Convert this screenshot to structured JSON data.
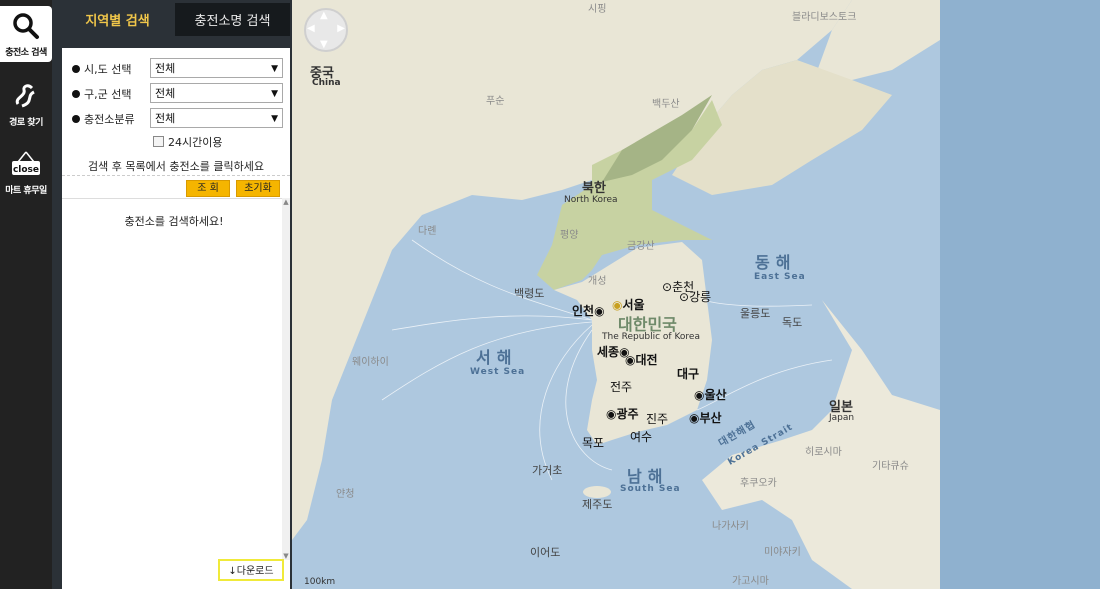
{
  "rail": {
    "items": [
      {
        "label": "충전소 검색",
        "icon": "search-icon"
      },
      {
        "label": "경로 찾기",
        "icon": "route-icon"
      },
      {
        "label": "마트 휴무일",
        "icon": "close-sign-icon",
        "badge": "close"
      }
    ]
  },
  "tabs": [
    {
      "label": "지역별 검색"
    },
    {
      "label": "충전소명 검색"
    }
  ],
  "form": {
    "sido_label": "시,도 선택",
    "sido_value": "전체",
    "gugun_label": "구,군 선택",
    "gugun_value": "전체",
    "type_label": "충전소분류",
    "type_value": "전체",
    "allday_label": "24시간이용",
    "hint": "검색 후 목록에서 충전소를 클릭하세요"
  },
  "buttons": {
    "search": "조 회",
    "reset": "초기화",
    "download": "다운로드"
  },
  "list": {
    "empty_text": "충전소를 검색하세요!"
  },
  "map": {
    "labels": {
      "china": "중국",
      "china_en": "China",
      "north": "북한",
      "north_en": "North Korea",
      "south": "대한민국",
      "south_en": "The Republic of Korea",
      "east_sea": "동해",
      "east_sea_en": "East Sea",
      "west_sea": "서해",
      "west_sea_en": "West Sea",
      "south_sea": "남해",
      "south_sea_en": "South Sea",
      "japan": "일본",
      "japan_en": "Japan",
      "strait": "대한해협",
      "strait_en": "Korea Strait",
      "seoul": "서울",
      "incheon": "인천",
      "chuncheon": "춘천",
      "gangneung": "강릉",
      "sejong": "세종",
      "daejeon": "대전",
      "daegu": "대구",
      "ulsan": "울산",
      "busan": "부산",
      "jeonju": "전주",
      "gwangju": "광주",
      "jinju": "진주",
      "mokpo": "목포",
      "yeosu": "여수",
      "jeju": "제주도",
      "ulleungdo": "울릉도",
      "dokdo": "독도",
      "baengnyeong": "백령도",
      "pyongyang": "평양",
      "kaesong": "개성",
      "gaekdusan": "백두산",
      "wonsan": "금강산",
      "vladivostok": "블라디보스토크",
      "fusun": "푸순",
      "siping": "시핑",
      "dalian": "다롄",
      "weihai": "웨이하이",
      "qingdao": "칭다오",
      "yantai": "옌타이",
      "yancheng": "얀청",
      "hiroshima": "히로시마",
      "fukuoka": "후쿠오카",
      "kitakyushu": "기타큐슈",
      "nagasaki": "나가사키",
      "miyazaki": "미야자키",
      "kagoshima": "가고시마",
      "gageocho": "가거초",
      "ieodo": "이어도"
    },
    "scale": "100km"
  }
}
